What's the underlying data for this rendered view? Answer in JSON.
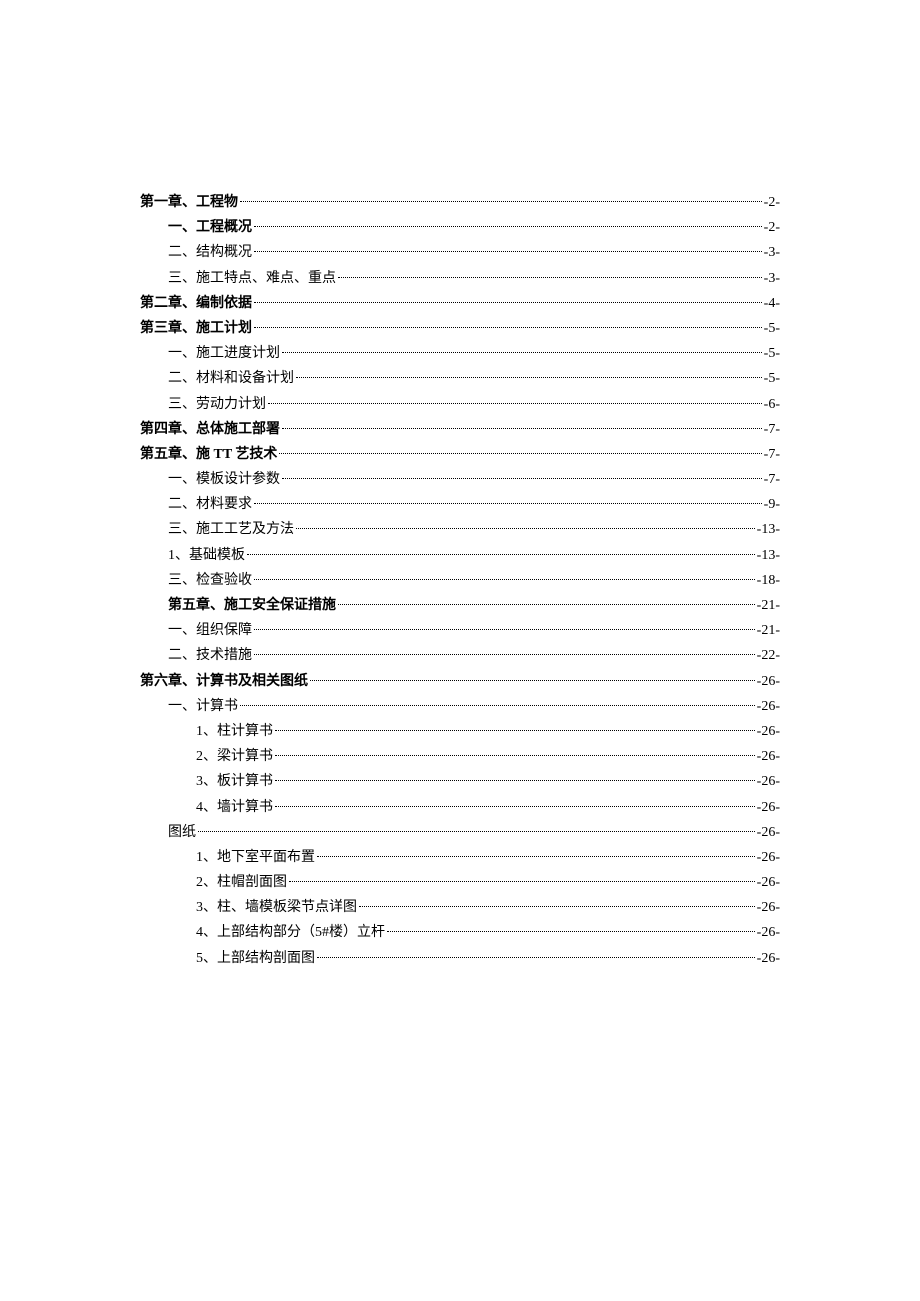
{
  "toc": [
    {
      "label": "第一章、工程物",
      "page": "-2-",
      "indent": 0,
      "bold": true
    },
    {
      "label": "一、工程概况",
      "page": "-2-",
      "indent": 1,
      "bold": true
    },
    {
      "label": "二、结构概况",
      "page": "-3-",
      "indent": 1,
      "bold": false
    },
    {
      "label": "三、施工特点、难点、重点",
      "page": "-3-",
      "indent": 1,
      "bold": false
    },
    {
      "label": "第二章、编制依据",
      "page": "-4-",
      "indent": 0,
      "bold": true
    },
    {
      "label": "第三章、施工计划",
      "page": "-5-",
      "indent": 0,
      "bold": true
    },
    {
      "label": "一、施工进度计划",
      "page": "-5-",
      "indent": 1,
      "bold": false
    },
    {
      "label": "二、材料和设备计划",
      "page": "-5-",
      "indent": 1,
      "bold": false
    },
    {
      "label": "三、劳动力计划",
      "page": "-6-",
      "indent": 1,
      "bold": false
    },
    {
      "label": "第四章、总体施工部署",
      "page": "-7-",
      "indent": 0,
      "bold": true
    },
    {
      "label": "第五章、施 TT 艺技术",
      "page": "-7-",
      "indent": 0,
      "bold": true
    },
    {
      "label": "一、模板设计参数",
      "page": "-7-",
      "indent": 1,
      "bold": false
    },
    {
      "label": "二、材料要求",
      "page": "-9-",
      "indent": 1,
      "bold": false
    },
    {
      "label": "三、施工工艺及方法",
      "page": "-13-",
      "indent": 1,
      "bold": false
    },
    {
      "label": "1、基础模板",
      "page": "-13-",
      "indent": 1,
      "bold": false
    },
    {
      "label": "三、检查验收",
      "page": "-18-",
      "indent": 1,
      "bold": false
    },
    {
      "label": "第五章、施工安全保证措施",
      "page": "-21-",
      "indent": 1,
      "bold": true
    },
    {
      "label": "一、组织保障",
      "page": "-21-",
      "indent": 1,
      "bold": false
    },
    {
      "label": "二、技术措施",
      "page": "-22-",
      "indent": 1,
      "bold": false
    },
    {
      "label": "第六章、计算书及相关图纸",
      "page": "-26-",
      "indent": 0,
      "bold": true
    },
    {
      "label": "一、计算书",
      "page": "-26-",
      "indent": 1,
      "bold": false
    },
    {
      "label": "1、柱计算书",
      "page": "-26-",
      "indent": 2,
      "bold": false
    },
    {
      "label": "2、梁计算书",
      "page": "-26-",
      "indent": 2,
      "bold": false
    },
    {
      "label": "3、板计算书",
      "page": "-26-",
      "indent": 2,
      "bold": false
    },
    {
      "label": "4、墙计算书",
      "page": "-26-",
      "indent": 2,
      "bold": false
    },
    {
      "label": "图纸",
      "page": "-26-",
      "indent": 1,
      "bold": false
    },
    {
      "label": "1、地下室平面布置",
      "page": "-26-",
      "indent": 2,
      "bold": false
    },
    {
      "label": "2、柱帽剖面图",
      "page": "-26-",
      "indent": 2,
      "bold": false
    },
    {
      "label": "3、柱、墙模板梁节点详图",
      "page": "-26-",
      "indent": 2,
      "bold": false
    },
    {
      "label": "4、上部结构部分（5#楼）立杆",
      "page": "-26-",
      "indent": 2,
      "bold": false
    },
    {
      "label": "5、上部结构剖面图",
      "page": "-26-",
      "indent": 2,
      "bold": false
    }
  ]
}
